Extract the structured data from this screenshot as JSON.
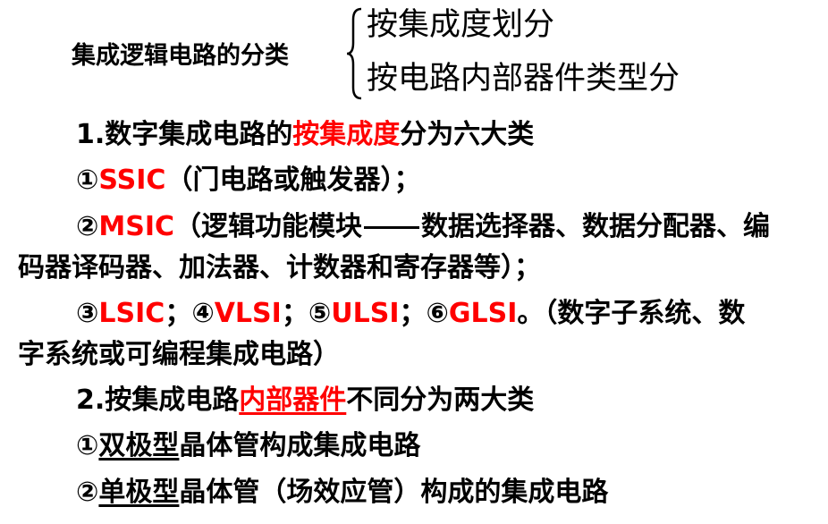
{
  "header": {
    "title": "集成逻辑电路的分类",
    "branch1": "按集成度划分",
    "branch2": "按电路内部器件类型分"
  },
  "section1": {
    "heading_prefix": "1.数字集成电路的",
    "heading_highlight": "按集成度",
    "heading_suffix": "分为六大类",
    "item1_num": "①",
    "item1_name": "SSIC",
    "item1_desc": "（门电路或触发器）；",
    "item2_num": "②",
    "item2_name": "MSIC",
    "item2_desc_a": "（逻辑功能模块",
    "item2_desc_b": "数据选择器、数据分配器、编",
    "item2_desc_c": "码器译码器、加法器、计数器和寄存器等）；",
    "item3_num": "③",
    "item3_name": "LSIC",
    "sep1": "；",
    "item4_num": "④",
    "item4_name": "VLSI",
    "sep2": "；",
    "item5_num": "⑤",
    "item5_name": "ULSI",
    "sep3": "；",
    "item6_num": "⑥",
    "item6_name": "GLSI",
    "item6_desc_a": "。（数字子系统、数",
    "item6_desc_b": "字系统或可编程集成电路）"
  },
  "section2": {
    "heading_prefix": "2.按集成电路",
    "heading_highlight": "内部器件",
    "heading_suffix": "不同分为两大类",
    "item1_num": "①",
    "item1_key": "双极型",
    "item1_desc": "晶体管构成集成电路",
    "item2_num": "②",
    "item2_key": "单极型",
    "item2_desc": "晶体管（场效应管）构成的集成电路"
  },
  "colors": {
    "highlight": "#ff0000",
    "text": "#000000"
  }
}
